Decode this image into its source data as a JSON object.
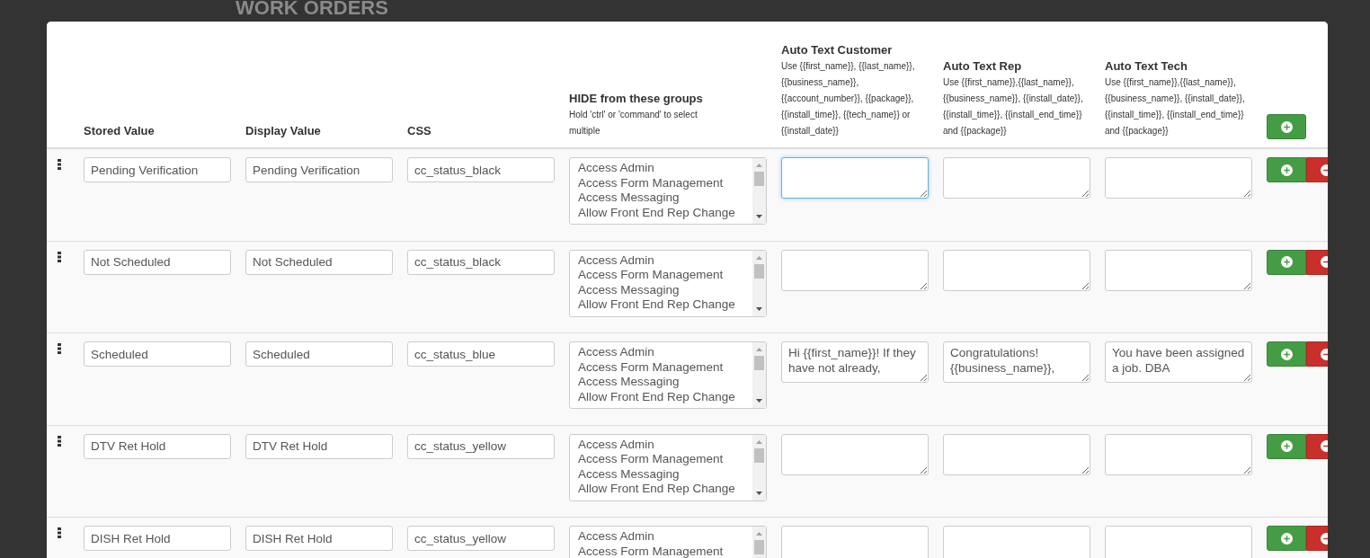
{
  "background_title": "WORK ORDERS",
  "header": {
    "stored": "Stored Value",
    "display": "Display Value",
    "css": "CSS",
    "groups": {
      "title": "HIDE from these groups",
      "hint": "Hold 'ctrl' or 'command' to select multiple"
    },
    "auto_texts": [
      {
        "title": "Auto Text Customer",
        "hint": "Use {{first_name}}, {{last_name}}, {{business_name}}, {{account_number}}, {{package}}, {{install_time}}, {{tech_name}} or {{install_date}}"
      },
      {
        "title": "Auto Text Rep",
        "hint": "Use {{first_name}},{{last_name}}, {{business_name}}, {{install_date}},{{install_time}}, {{install_end_time}} and {{package}}"
      },
      {
        "title": "Auto Text Tech",
        "hint": "Use {{first_name}},{{last_name}}, {{business_name}}, {{install_date}},{{install_time}}, {{install_end_time}} and {{package}}"
      }
    ]
  },
  "rows": [
    {
      "stored": "Pending Verification",
      "display": "Pending Verification",
      "css": "cc_status_black",
      "groups": [
        "Access Admin",
        "Access Form Management",
        "Access Messaging",
        "Allow Front End Rep Change"
      ],
      "auto_texts": [
        {
          "focused": true
        },
        {
          "focused": false
        },
        {
          "focused": false
        }
      ]
    },
    {
      "stored": "Not Scheduled",
      "display": "Not Scheduled",
      "css": "cc_status_black",
      "groups": [
        "Access Admin",
        "Access Form Management",
        "Access Messaging",
        "Allow Front End Rep Change"
      ],
      "auto_texts": [
        {
          "focused": false
        },
        {
          "focused": false
        },
        {
          "focused": false
        }
      ]
    },
    {
      "stored": "Scheduled",
      "display": "Scheduled",
      "css": "cc_status_blue",
      "groups": [
        "Access Admin",
        "Access Form Management",
        "Access Messaging",
        "Allow Front End Rep Change"
      ],
      "auto_texts": [
        {
          "value": "Hi {{first_name}}! If they have not already,",
          "focused": false
        },
        {
          "value": "Congratulations! {{business_name}},",
          "focused": false
        },
        {
          "value": "You have been assigned a job. DBA",
          "focused": false
        }
      ]
    },
    {
      "stored": "DTV Ret Hold",
      "display": "DTV Ret Hold",
      "css": "cc_status_yellow",
      "groups": [
        "Access Admin",
        "Access Form Management",
        "Access Messaging",
        "Allow Front End Rep Change"
      ],
      "auto_texts": [
        {
          "focused": false
        },
        {
          "focused": false
        },
        {
          "focused": false
        }
      ]
    },
    {
      "stored": "DISH Ret Hold",
      "display": "DISH Ret Hold",
      "css": "cc_status_yellow",
      "groups": [
        "Access Admin",
        "Access Form Management"
      ],
      "auto_texts": [
        {
          "focused": false
        },
        {
          "focused": false
        },
        {
          "focused": false
        }
      ]
    }
  ]
}
